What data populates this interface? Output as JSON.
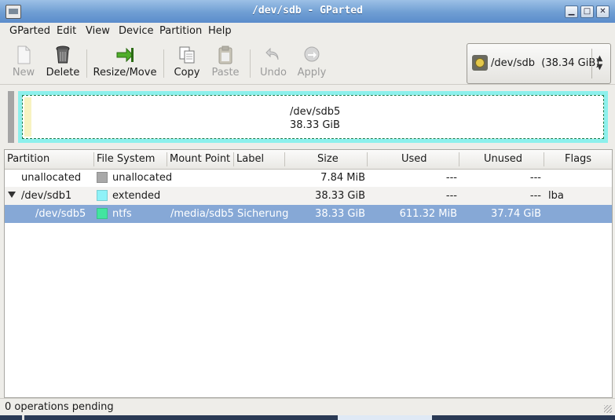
{
  "window": {
    "title": "/dev/sdb - GParted",
    "min": "▁",
    "max": "□",
    "close": "✕"
  },
  "menu": [
    "GParted",
    "Edit",
    "View",
    "Device",
    "Partition",
    "Help"
  ],
  "toolbar": {
    "new": "New",
    "delete": "Delete",
    "resize": "Resize/Move",
    "copy": "Copy",
    "paste": "Paste",
    "undo": "Undo",
    "apply": "Apply"
  },
  "device_selector": {
    "device": "/dev/sdb",
    "size": "(38.34 GiB)"
  },
  "disk_map": {
    "name": "/dev/sdb5",
    "size": "38.33 GiB"
  },
  "columns": [
    "Partition",
    "File System",
    "Mount Point",
    "Label",
    "Size",
    "Used",
    "Unused",
    "Flags"
  ],
  "rows": [
    {
      "partition": "unallocated",
      "fs": "unallocated",
      "fs_color": "#a8a8a8",
      "mount": "",
      "label": "",
      "size": "7.84 MiB",
      "used": "---",
      "unused": "---",
      "flags": ""
    },
    {
      "partition": "/dev/sdb1",
      "fs": "extended",
      "fs_color": "#8ef2f8",
      "mount": "",
      "label": "",
      "size": "38.33 GiB",
      "used": "---",
      "unused": "---",
      "flags": "lba"
    },
    {
      "partition": "/dev/sdb5",
      "fs": "ntfs",
      "fs_color": "#42e5a0",
      "mount": "/media/sdb5",
      "label": "Sicherung",
      "size": "38.33 GiB",
      "used": "611.32 MiB",
      "unused": "37.74 GiB",
      "flags": ""
    }
  ],
  "status": "0 operations pending"
}
